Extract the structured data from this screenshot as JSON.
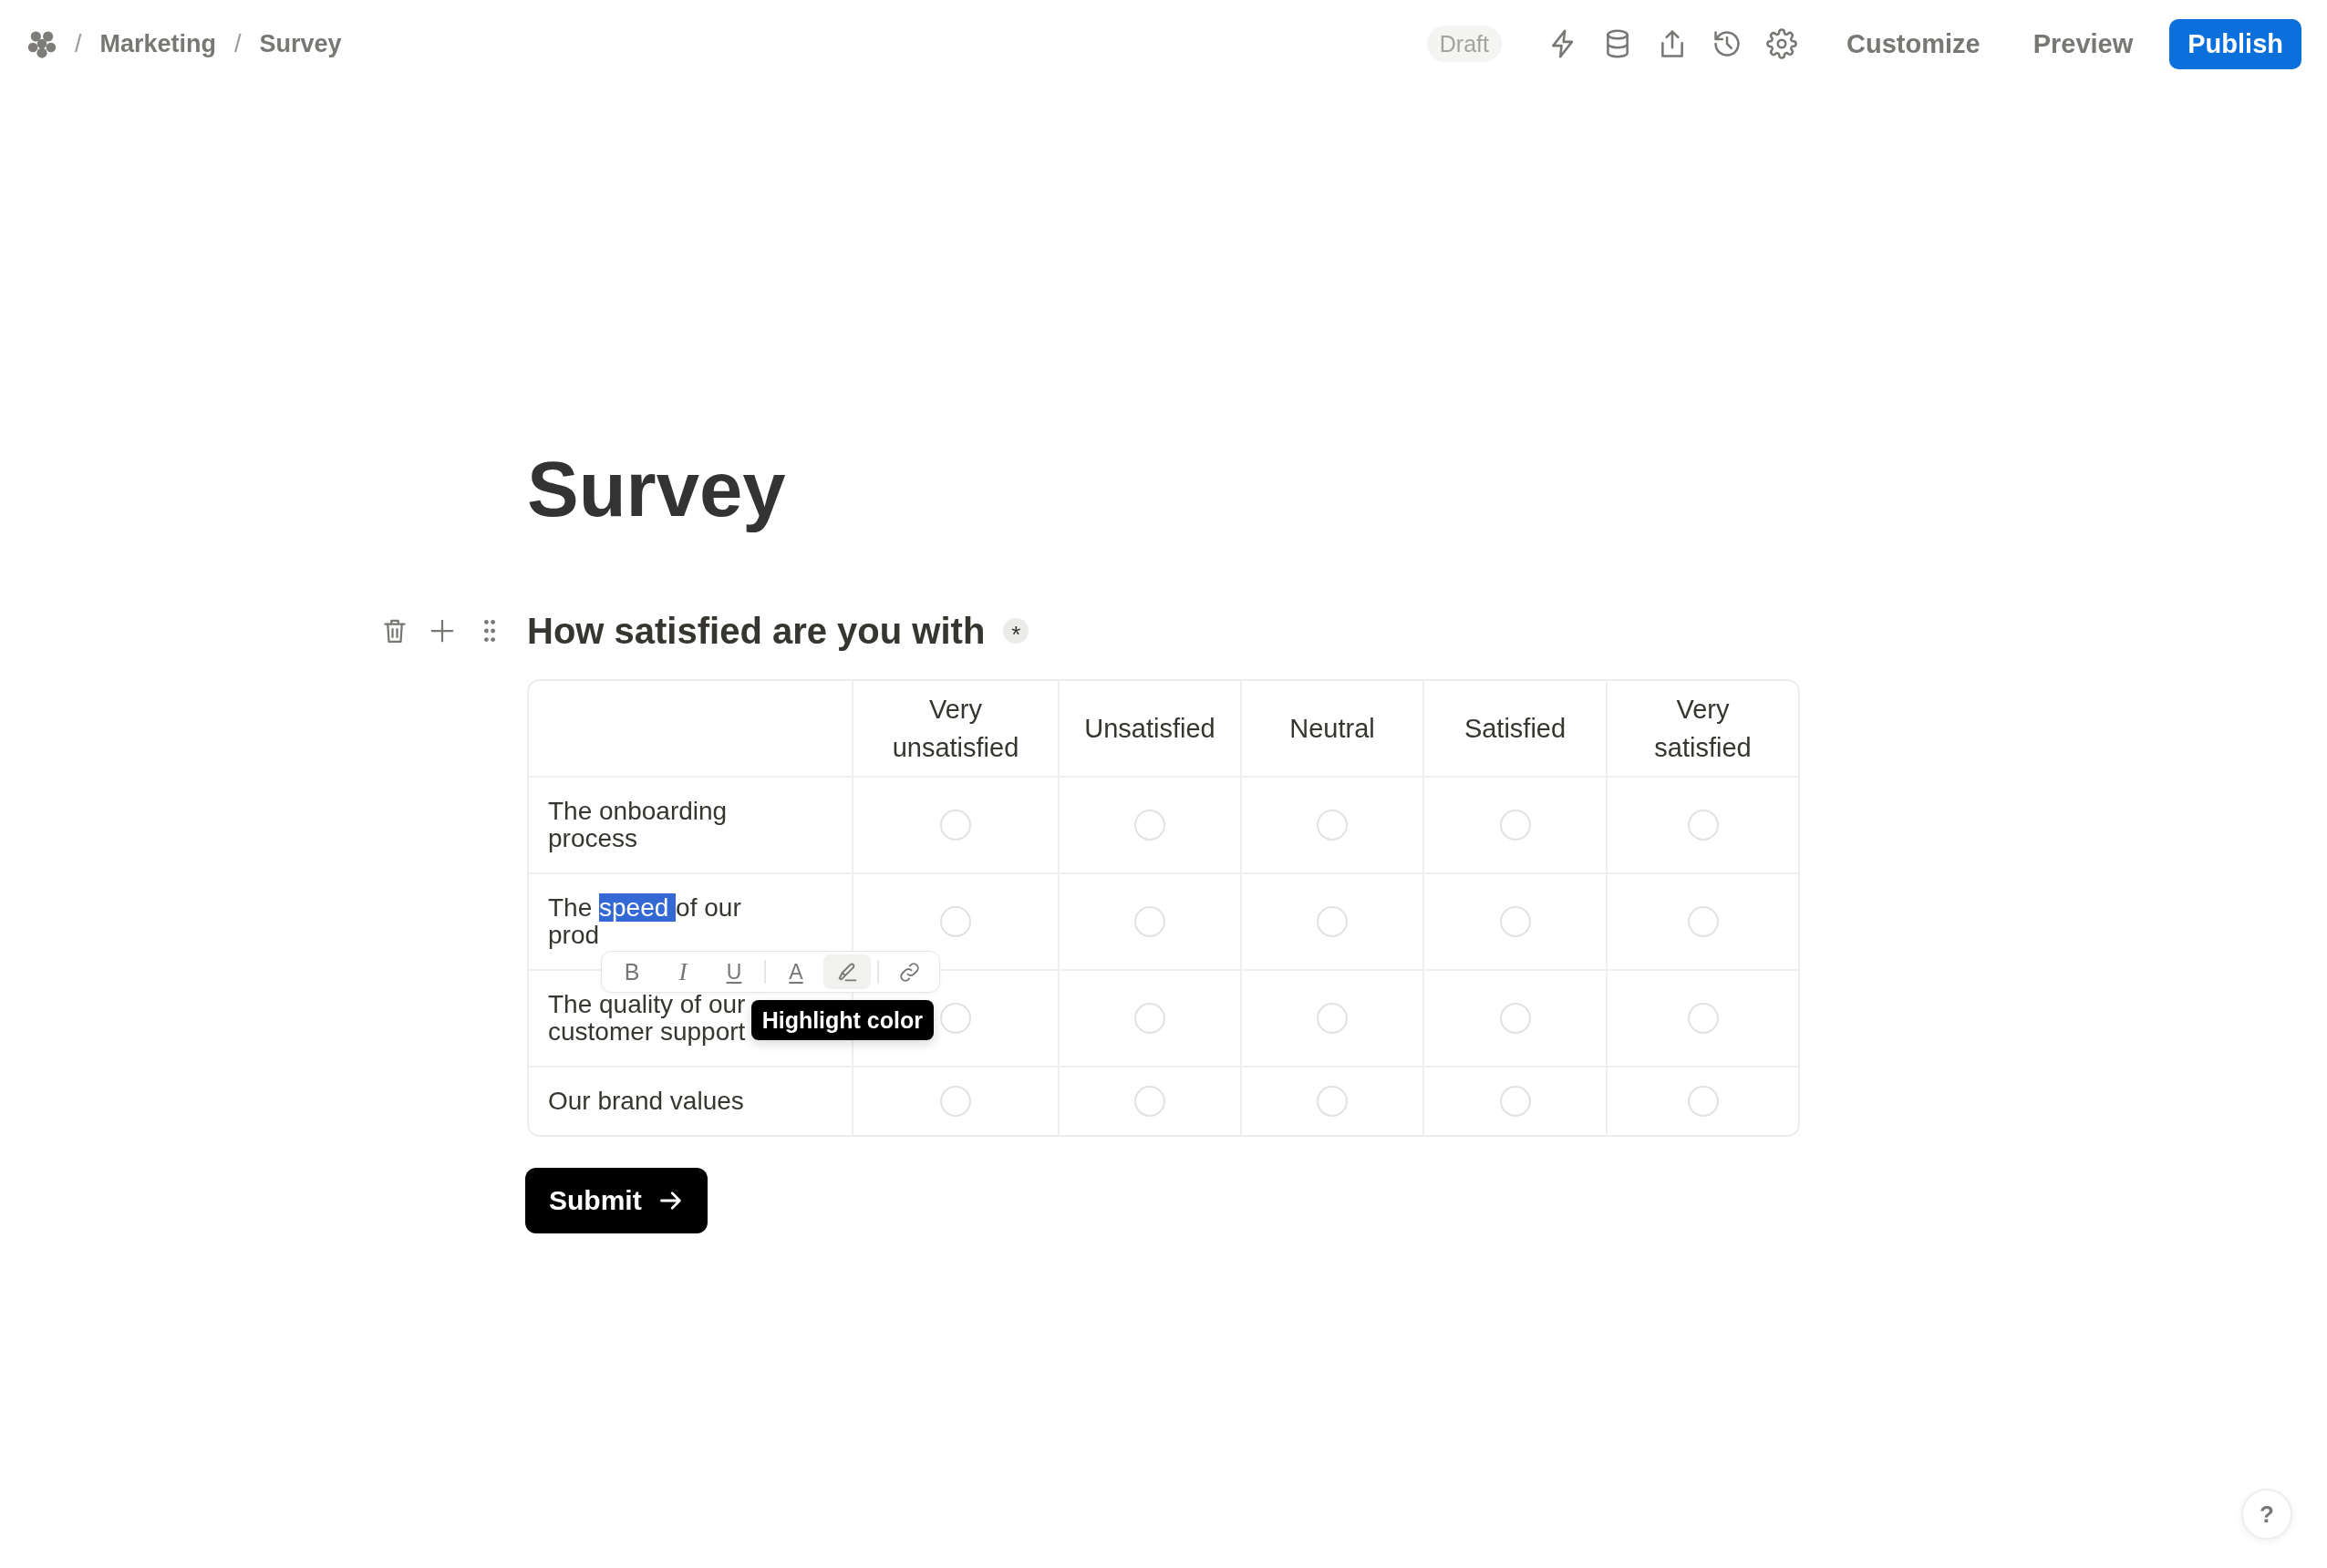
{
  "header": {
    "breadcrumb": [
      {
        "separator": "/",
        "label": "Marketing"
      },
      {
        "separator": "/",
        "label": "Survey"
      }
    ],
    "status": "Draft",
    "actions": [
      {
        "label": "Customize",
        "kind": "plain"
      },
      {
        "label": "Preview",
        "kind": "plain"
      },
      {
        "label": "Publish",
        "kind": "primary"
      }
    ]
  },
  "page": {
    "title": "Survey"
  },
  "question": {
    "title": "How satisfied are you with",
    "required_mark": "*",
    "columns": [
      "Very unsatisfied",
      "Unsatisfied",
      "Neutral",
      "Satisfied",
      "Very satisfied"
    ],
    "rows": [
      {
        "label_parts": [
          {
            "text": "The onboarding process",
            "selected": false
          }
        ],
        "options": [
          {
            "selected": false
          },
          {
            "selected": false
          },
          {
            "selected": false
          },
          {
            "selected": false
          },
          {
            "selected": false
          }
        ]
      },
      {
        "label_parts": [
          {
            "text": "The ",
            "selected": false
          },
          {
            "text": "speed ",
            "selected": true
          },
          {
            "text": "of our prod",
            "selected": false
          }
        ],
        "options": [
          {
            "selected": false
          },
          {
            "selected": false
          },
          {
            "selected": false
          },
          {
            "selected": false
          },
          {
            "selected": false
          }
        ]
      },
      {
        "label_parts": [
          {
            "text": "The quality of our customer support",
            "selected": false
          }
        ],
        "options": [
          {
            "selected": false
          },
          {
            "selected": false
          },
          {
            "selected": false
          },
          {
            "selected": false
          },
          {
            "selected": false
          }
        ]
      },
      {
        "label_parts": [
          {
            "text": "Our brand values",
            "selected": false
          }
        ],
        "options": [
          {
            "selected": false
          },
          {
            "selected": false
          },
          {
            "selected": false
          },
          {
            "selected": false
          },
          {
            "selected": false
          }
        ]
      }
    ]
  },
  "formatting_toolbar": {
    "groups": [
      {
        "items": [
          {
            "kind": "bold",
            "label": "B",
            "active": false
          },
          {
            "kind": "italic",
            "label": "I",
            "active": false
          },
          {
            "kind": "underline",
            "label": "U",
            "active": false
          }
        ]
      },
      {
        "items": [
          {
            "kind": "text_color",
            "label": "A",
            "active": false
          },
          {
            "kind": "highlight",
            "active": true
          }
        ]
      },
      {
        "items": [
          {
            "kind": "link",
            "active": false
          }
        ]
      }
    ]
  },
  "tooltip": {
    "text": "Highlight color"
  },
  "submit_button": {
    "label": "Submit"
  },
  "help_button": {
    "label": "?"
  }
}
